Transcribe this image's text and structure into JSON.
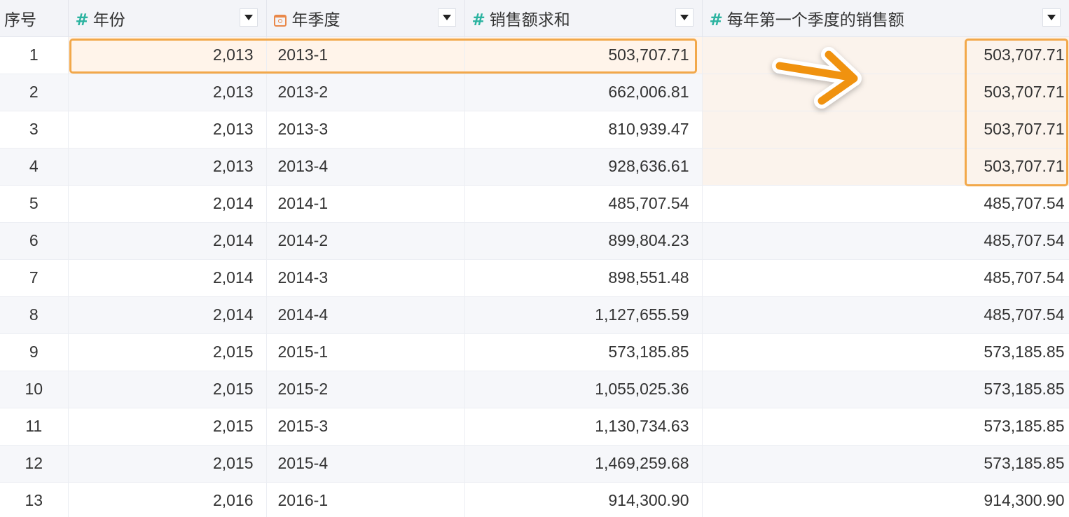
{
  "headers": {
    "seq": "序号",
    "year": "年份",
    "quarter": "年季度",
    "sales_sum": "销售额求和",
    "first_quarter_sales": "每年第一个季度的销售额"
  },
  "header_icons": {
    "year": "number-type-icon",
    "quarter": "date-type-icon",
    "sales_sum": "number-type-icon",
    "first_quarter_sales": "number-type-icon"
  },
  "rows": [
    {
      "seq": "1",
      "year": "2,013",
      "quarter": "2013-1",
      "sales": "503,707.71",
      "first": "503,707.71"
    },
    {
      "seq": "2",
      "year": "2,013",
      "quarter": "2013-2",
      "sales": "662,006.81",
      "first": "503,707.71"
    },
    {
      "seq": "3",
      "year": "2,013",
      "quarter": "2013-3",
      "sales": "810,939.47",
      "first": "503,707.71"
    },
    {
      "seq": "4",
      "year": "2,013",
      "quarter": "2013-4",
      "sales": "928,636.61",
      "first": "503,707.71"
    },
    {
      "seq": "5",
      "year": "2,014",
      "quarter": "2014-1",
      "sales": "485,707.54",
      "first": "485,707.54"
    },
    {
      "seq": "6",
      "year": "2,014",
      "quarter": "2014-2",
      "sales": "899,804.23",
      "first": "485,707.54"
    },
    {
      "seq": "7",
      "year": "2,014",
      "quarter": "2014-3",
      "sales": "898,551.48",
      "first": "485,707.54"
    },
    {
      "seq": "8",
      "year": "2,014",
      "quarter": "2014-4",
      "sales": "1,127,655.59",
      "first": "485,707.54"
    },
    {
      "seq": "9",
      "year": "2,015",
      "quarter": "2015-1",
      "sales": "573,185.85",
      "first": "573,185.85"
    },
    {
      "seq": "10",
      "year": "2,015",
      "quarter": "2015-2",
      "sales": "1,055,025.36",
      "first": "573,185.85"
    },
    {
      "seq": "11",
      "year": "2,015",
      "quarter": "2015-3",
      "sales": "1,130,734.63",
      "first": "573,185.85"
    },
    {
      "seq": "12",
      "year": "2,015",
      "quarter": "2015-4",
      "sales": "1,469,259.68",
      "first": "573,185.85"
    },
    {
      "seq": "13",
      "year": "2,016",
      "quarter": "2016-1",
      "sales": "914,300.90",
      "first": "914,300.90"
    }
  ],
  "colors": {
    "accent_teal": "#2bb3a0",
    "date_orange": "#e9884a",
    "highlight_border": "#f2a84a",
    "arrow": "#f0920f"
  }
}
